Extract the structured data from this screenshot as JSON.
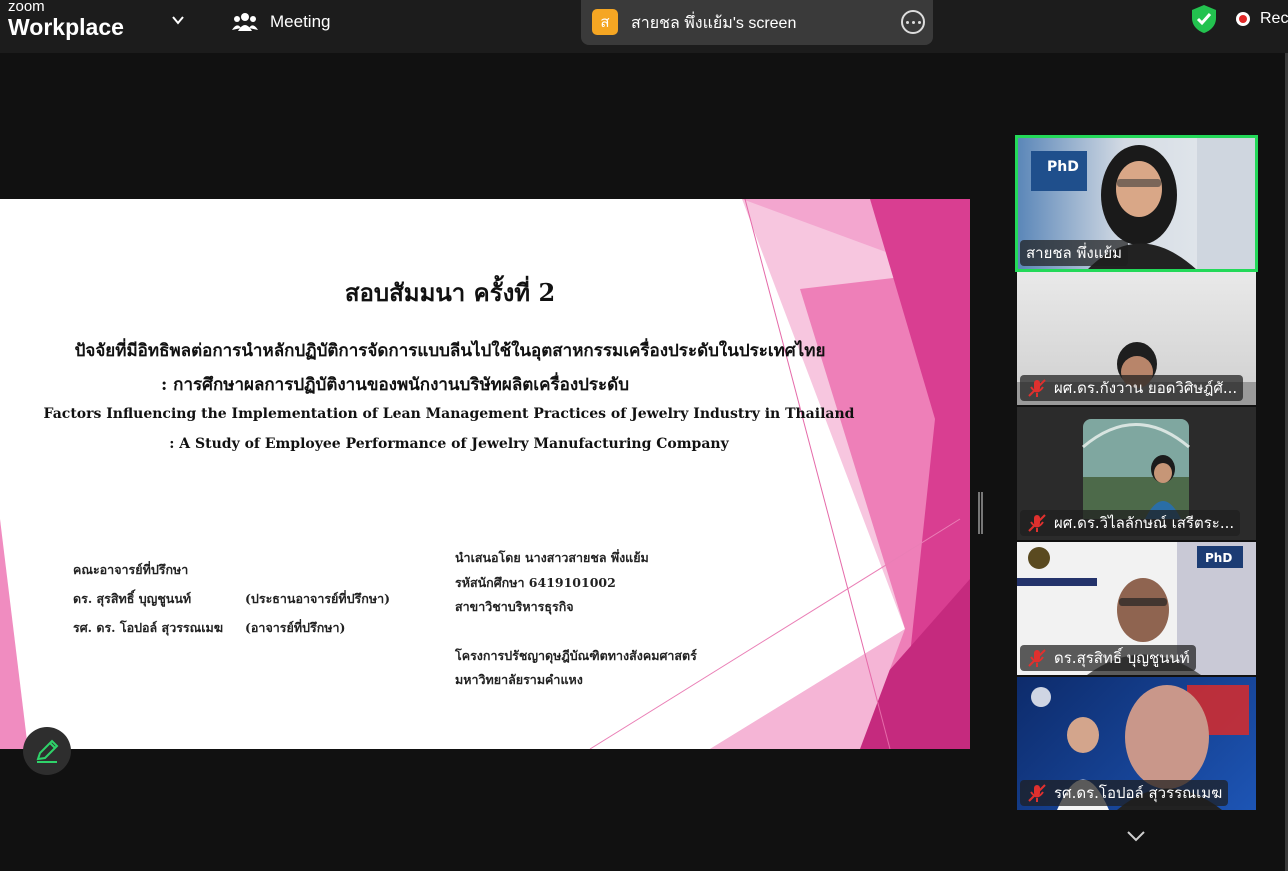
{
  "app": {
    "brand_small": "zoom",
    "brand_big": "Workplace",
    "meeting_label": "Meeting",
    "share_avatar": "ส",
    "share_title": "สายชล พึ่งแย้ม's screen",
    "recording_label": "Rec",
    "accent": "#23d959",
    "share_avatar_color": "#f5a623"
  },
  "slide": {
    "title": "สอบสัมมนา ครั้งที่ 2",
    "thai_line1": "ปัจจัยที่มีอิทธิพลต่อการนำหลักปฏิบัติการจัดการแบบลีนไปใช้ในอุตสาหกรรมเครื่องประดับในประเทศไทย",
    "thai_line2": ": การศึกษาผลการปฏิบัติงานของพนักงานบริษัทผลิตเครื่องประดับ",
    "en_line1": "Factors Influencing the Implementation of Lean Management Practices of Jewelry Industry in Thailand",
    "en_line2": ": A Study of Employee Performance of Jewelry Manufacturing Company",
    "advisors_heading": "คณะอาจารย์ที่ปรึกษา",
    "advisors": [
      {
        "name": "ดร. สุรสิทธิ์  บุญชูนนท์",
        "role": "(ประธานอาจารย์ที่ปรึกษา)"
      },
      {
        "name": "รศ. ดร. โอปอล์  สุวรรณเมฆ",
        "role": "(อาจารย์ที่ปรึกษา)"
      }
    ],
    "presenter": "นำเสนอโดย นางสาวสายชล  พึ่งแย้ม",
    "student_id": "รหัสนักศึกษา  6419101002",
    "major": "สาขาวิชาบริหารธุรกิจ",
    "program": "โครงการปรัชญาดุษฎีบัณฑิตทางสังคมศาสตร์",
    "university": "มหาวิทยาลัยรามคำแหง"
  },
  "participants": [
    {
      "name": "สายชล พึ่งแย้ม",
      "muted": false,
      "active": true
    },
    {
      "name": "ผศ.ดร.กังวาน  ยอดวิศิษฎ์ศั...",
      "muted": true,
      "active": false
    },
    {
      "name": "ผศ.ดร.วิไลลักษณ์  เสรีตระ...",
      "muted": true,
      "active": false
    },
    {
      "name": "ดร.สุรสิทธิ์  บุญชูนนท์",
      "muted": true,
      "active": false
    },
    {
      "name": "รศ.ดร.โอปอล์  สุวรรณเมฆ",
      "muted": true,
      "active": false
    }
  ],
  "icons": [
    "chevron-down-icon",
    "meeting-people-icon",
    "more-options-icon",
    "security-shield-icon",
    "recording-dot-icon",
    "annotate-pencil-icon",
    "mic-muted-icon",
    "scroll-down-chevron-icon"
  ]
}
